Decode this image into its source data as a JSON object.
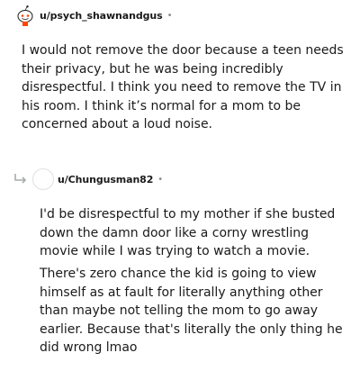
{
  "comments": [
    {
      "username": "u/psych_shawnandgus",
      "separator": "•",
      "body": "I would not remove the door because a teen needs their privacy, but he was being incredibly disrespectful. I think you need to remove the TV in his room. I think it’s normal for a mom to be concerned about a loud noise."
    },
    {
      "username": "u/Chungusman82",
      "separator": "•",
      "paragraphs": [
        "I'd be disrespectful to my mother if she busted down the damn door like a corny wrestling movie while I was trying to watch a movie.",
        "There's zero chance the kid is going to view himself as at fault for literally anything other than maybe not telling the mom to go away earlier. Because that's literally the only thing he did wrong lmao"
      ]
    }
  ],
  "icons": {
    "avatar_1": "snoo-avatar-icon",
    "reply_arrow": "reply-arrow-icon",
    "avatar_2": "default-avatar-icon"
  },
  "colors": {
    "text": "#1a1a1b",
    "meta": "#878a8c",
    "snoo_accent": "#ff4500"
  }
}
